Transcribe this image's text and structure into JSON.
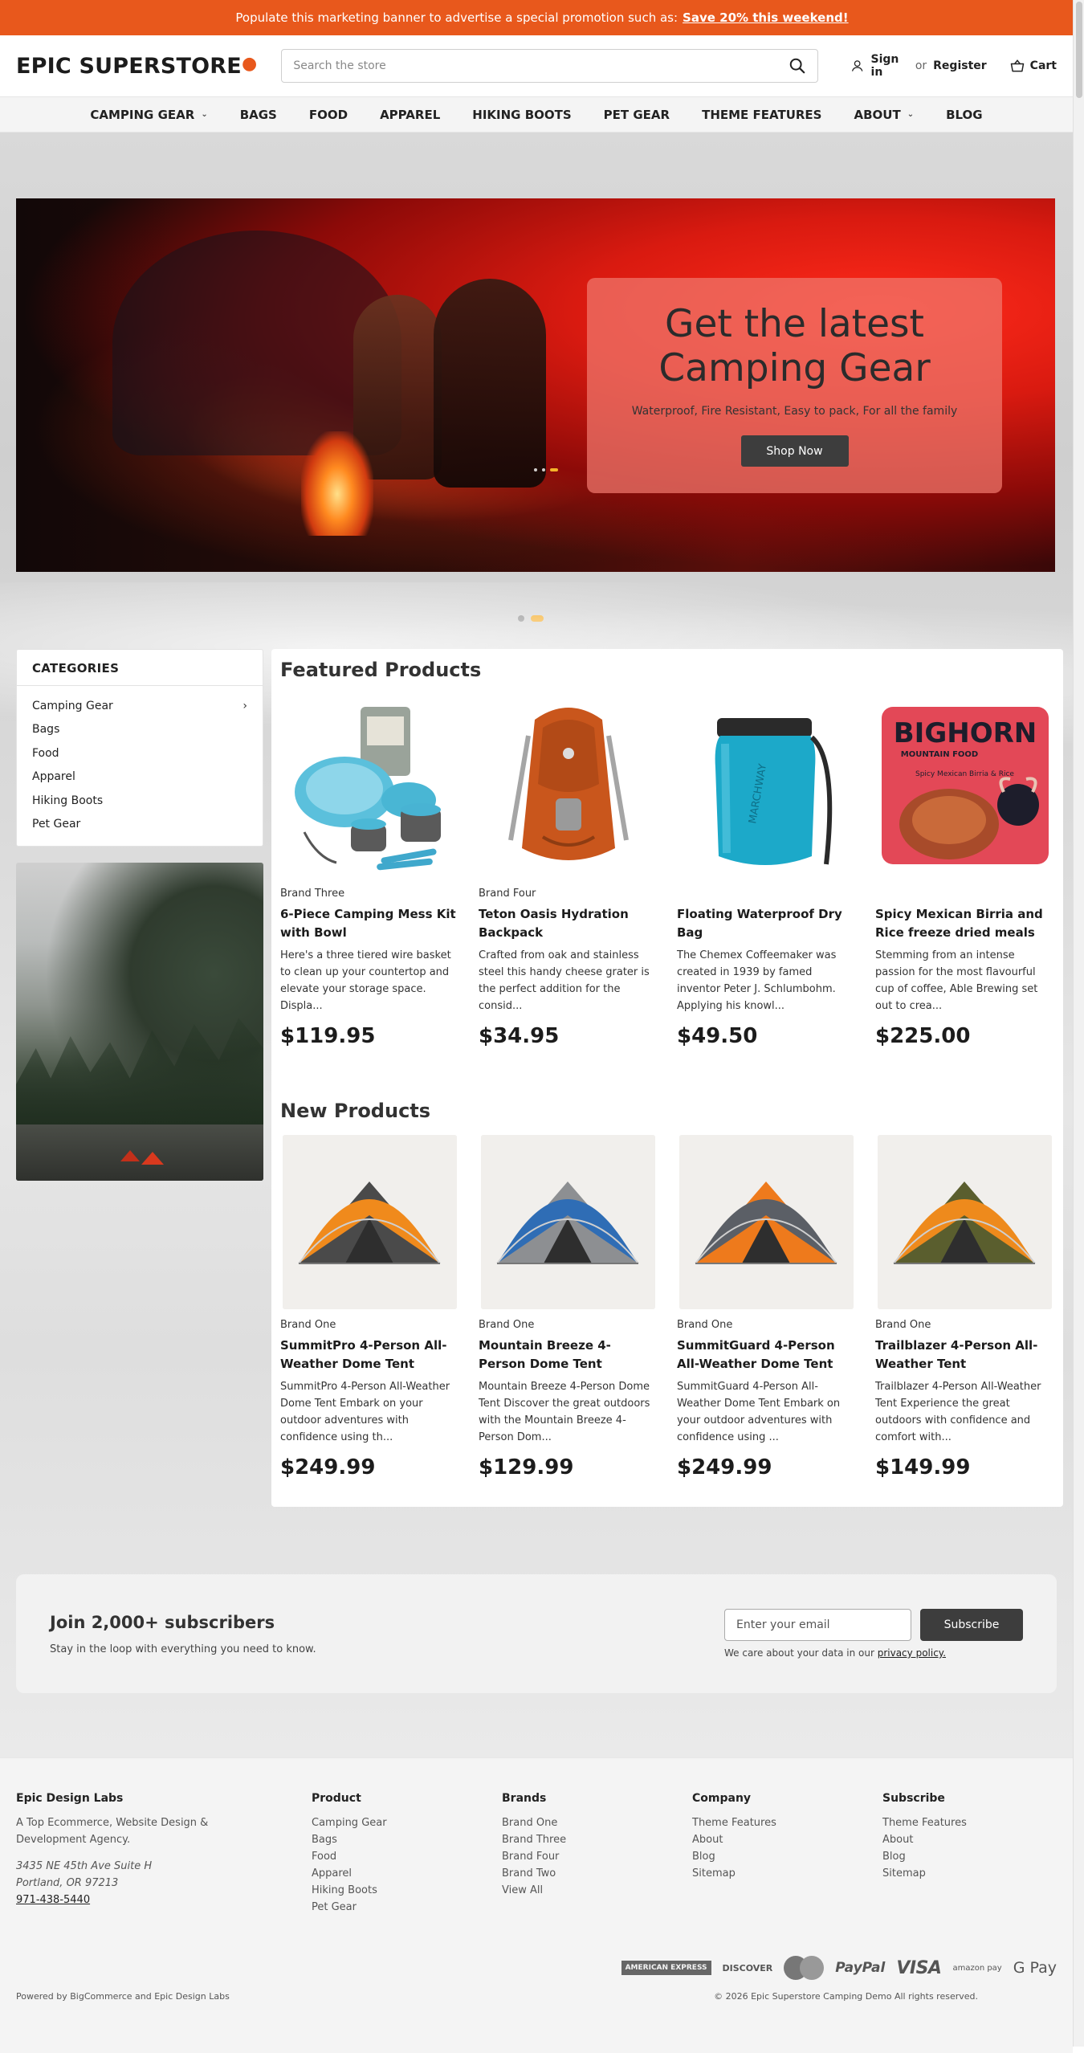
{
  "promo": {
    "text": "Populate this marketing banner to advertise a special promotion such as:",
    "link": "Save 20% this weekend!"
  },
  "header": {
    "logo": "EPIC SUPERSTORE",
    "search_placeholder": "Search the store",
    "sign_in": "Sign in",
    "or": "or",
    "register": "Register",
    "cart": "Cart"
  },
  "nav": [
    {
      "label": "CAMPING GEAR",
      "has_dropdown": true
    },
    {
      "label": "BAGS"
    },
    {
      "label": "FOOD"
    },
    {
      "label": "APPAREL"
    },
    {
      "label": "HIKING BOOTS"
    },
    {
      "label": "PET GEAR"
    },
    {
      "label": "THEME FEATURES"
    },
    {
      "label": "ABOUT",
      "has_dropdown": true
    },
    {
      "label": "BLOG"
    }
  ],
  "hero": {
    "title": "Get the latest Camping Gear",
    "subtitle": "Waterproof, Fire Resistant, Easy to pack, For all the family",
    "button": "Shop Now",
    "slide_count": 2,
    "active_slide": 2
  },
  "categories": {
    "title": "CATEGORIES",
    "items": [
      {
        "label": "Camping Gear",
        "has_children": true
      },
      {
        "label": "Bags"
      },
      {
        "label": "Food"
      },
      {
        "label": "Apparel"
      },
      {
        "label": "Hiking Boots"
      },
      {
        "label": "Pet Gear"
      }
    ]
  },
  "featured": {
    "title": "Featured Products",
    "products": [
      {
        "brand": "Brand Three",
        "name": "6-Piece Camping Mess Kit with Bowl",
        "desc": "Here's a three tiered wire basket to clean up your countertop and elevate your storage space. Displa...",
        "price": "$119.95",
        "image": "mess-kit"
      },
      {
        "brand": "Brand Four",
        "name": "Teton Oasis Hydration Backpack",
        "desc": "Crafted from oak and stainless steel this handy cheese grater is the perfect addition for the consid...",
        "price": "$34.95",
        "image": "backpack"
      },
      {
        "brand": "",
        "name": "Floating Waterproof Dry Bag",
        "desc": "The Chemex Coffeemaker was created in 1939 by famed inventor Peter J. Schlumbohm. Applying his knowl...",
        "price": "$49.50",
        "image": "dry-bag"
      },
      {
        "brand": "",
        "name": "Spicy Mexican Birria and Rice freeze dried meals",
        "desc": "Stemming from an intense passion for the most flavourful cup of coffee, Able Brewing set out to crea...",
        "price": "$225.00",
        "image": "food-pouch",
        "pouch_brand": "BIGHORN",
        "pouch_sub": "MOUNTAIN FOOD",
        "pouch_flavor": "Spicy Mexican Birria & Rice"
      }
    ]
  },
  "new_products": {
    "title": "New Products",
    "products": [
      {
        "brand": "Brand One",
        "name": "SummitPro 4-Person All-Weather Dome Tent",
        "desc": "SummitPro 4-Person All-Weather Dome Tent Embark on your outdoor adventures with confidence using th...",
        "price": "$249.99",
        "colors": {
          "fly": "#f08a1c",
          "body": "#4a4a4a"
        }
      },
      {
        "brand": "Brand One",
        "name": "Mountain Breeze 4-Person Dome Tent",
        "desc": "Mountain Breeze 4-Person Dome Tent Discover the great outdoors with the Mountain Breeze 4-Person Dom...",
        "price": "$129.99",
        "colors": {
          "fly": "#2f6db5",
          "body": "#8d8f92"
        }
      },
      {
        "brand": "Brand One",
        "name": "SummitGuard 4-Person All-Weather Dome Tent",
        "desc": "SummitGuard 4-Person All-Weather Dome Tent Embark on your outdoor adventures with confidence using ...",
        "price": "$249.99",
        "colors": {
          "fly": "#5b5f66",
          "body": "#ee7a1c"
        }
      },
      {
        "brand": "Brand One",
        "name": "Trailblazer 4-Person All-Weather Tent",
        "desc": "Trailblazer 4-Person All-Weather Tent Experience the great outdoors with confidence and comfort with...",
        "price": "$149.99",
        "colors": {
          "fly": "#ee8a1c",
          "body": "#5a5e2e"
        }
      }
    ]
  },
  "newsletter": {
    "title": "Join 2,000+ subscribers",
    "subtitle": "Stay in the loop with everything you need to know.",
    "placeholder": "Enter your email",
    "button": "Subscribe",
    "note": "We care about your data in our",
    "note_link": "privacy policy."
  },
  "footer": {
    "about": {
      "title": "Epic Design Labs",
      "tagline": "A Top Ecommerce, Website Design & Development Agency.",
      "address1": "3435 NE 45th Ave Suite H",
      "address2": "Portland, OR 97213",
      "phone": "971-438-5440"
    },
    "product": {
      "title": "Product",
      "links": [
        "Camping Gear",
        "Bags",
        "Food",
        "Apparel",
        "Hiking Boots",
        "Pet Gear"
      ]
    },
    "brands": {
      "title": "Brands",
      "links": [
        "Brand One",
        "Brand Three",
        "Brand Four",
        "Brand Two",
        "View All"
      ]
    },
    "company": {
      "title": "Company",
      "links": [
        "Theme Features",
        "About",
        "Blog",
        "Sitemap"
      ]
    },
    "subscribe": {
      "title": "Subscribe",
      "links": [
        "Theme Features",
        "About",
        "Blog",
        "Sitemap"
      ]
    },
    "payments": {
      "amex": "AMERICAN EXPRESS",
      "discover": "DISCOVER",
      "mastercard": "MasterCard",
      "paypal": "PayPal",
      "visa": "VISA",
      "amazon": "amazon pay",
      "gpay": "G Pay"
    },
    "powered": "Powered by BigCommerce and Epic Design Labs",
    "copyright": "© 2026 Epic Superstore Camping Demo All rights reserved."
  },
  "colors": {
    "accent": "#e8581c",
    "dark_button": "#3d3d3d",
    "dot_active": "#f4a81d"
  }
}
